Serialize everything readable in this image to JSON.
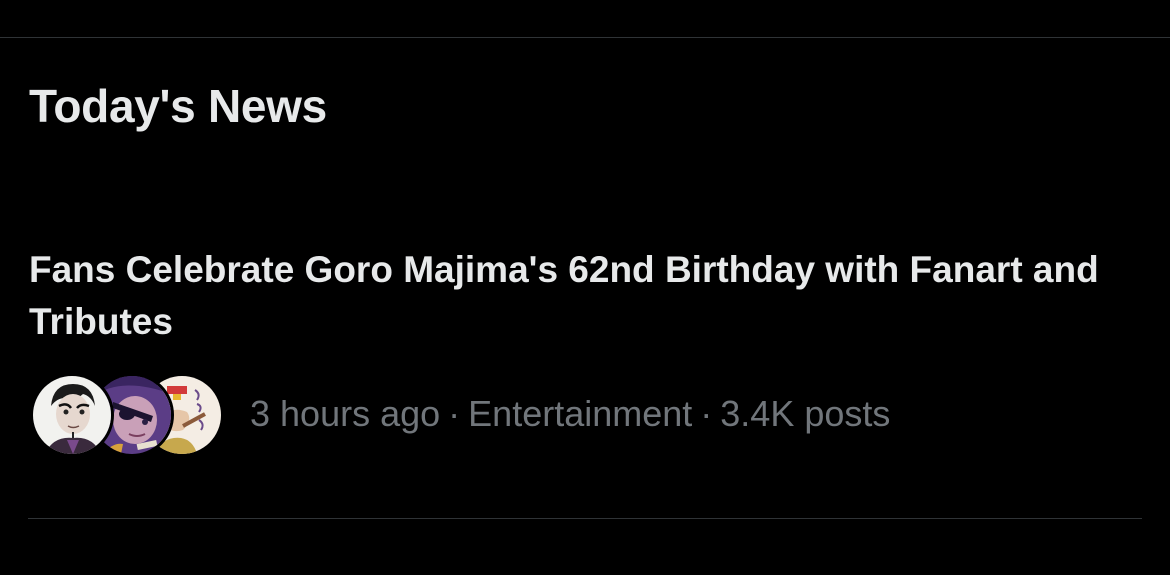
{
  "section": {
    "title": "Today's News"
  },
  "news": {
    "headline": "Fans Celebrate Goro Majima's 62nd Birthday with Fanart and Tributes",
    "time": "3 hours ago",
    "category": "Entertainment",
    "posts": "3.4K posts",
    "separator": "·",
    "avatars": [
      {
        "icon": "fanart-avatar-goro-icon"
      },
      {
        "icon": "fanart-avatar-majima-icon"
      },
      {
        "icon": "fanart-avatar-kiryu-icon"
      }
    ]
  },
  "colors": {
    "background": "#000000",
    "text_primary": "#e7e9ea",
    "text_secondary": "#71767b",
    "divider": "#2f3336"
  }
}
